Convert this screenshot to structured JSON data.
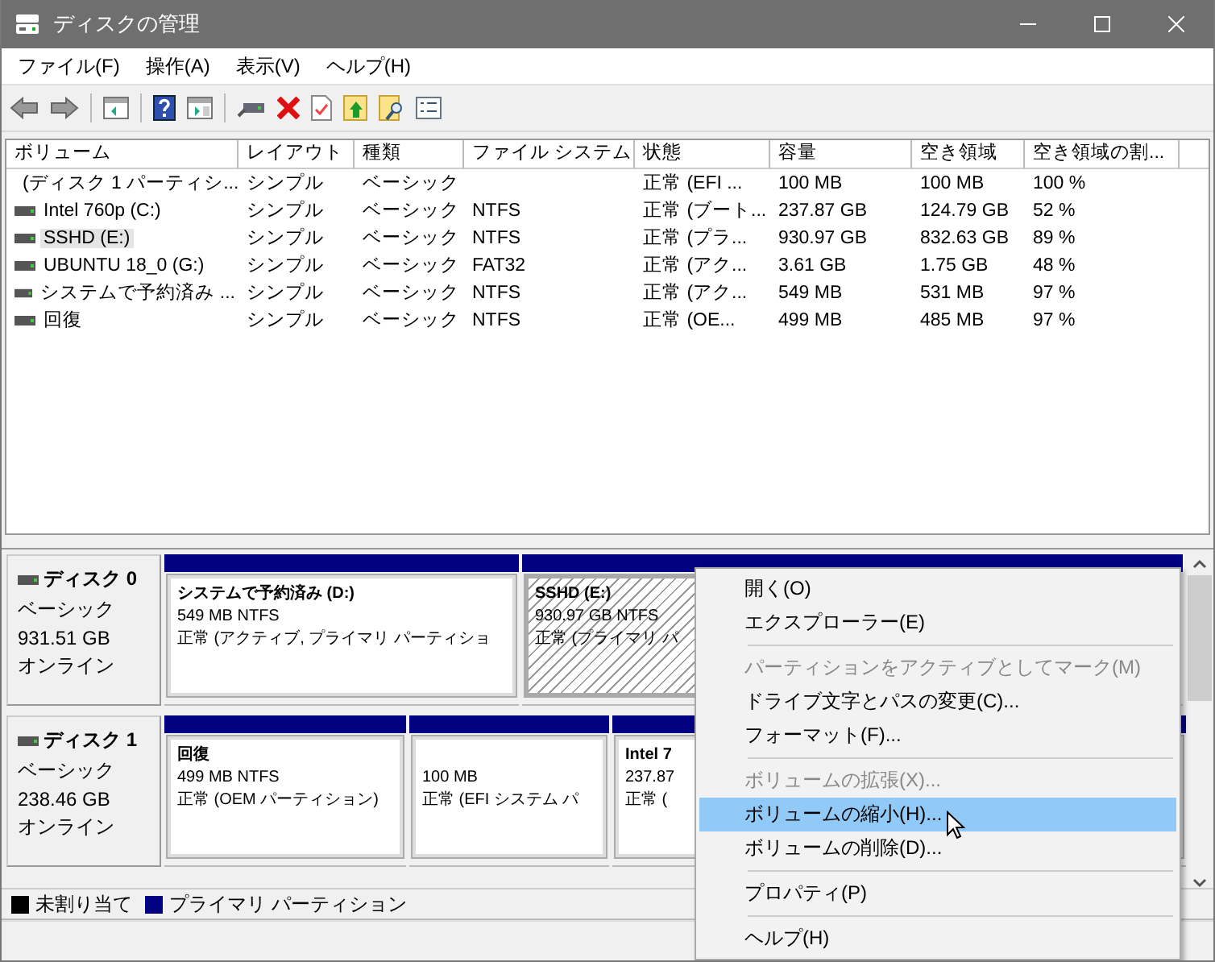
{
  "window": {
    "title": "ディスクの管理"
  },
  "menu_bar": [
    "ファイル(F)",
    "操作(A)",
    "表示(V)",
    "ヘルプ(H)"
  ],
  "volume_list": {
    "columns": [
      "ボリューム",
      "レイアウト",
      "種類",
      "ファイル システム",
      "状態",
      "容量",
      "空き領域",
      "空き領域の割..."
    ],
    "rows": [
      {
        "selected": false,
        "cells": [
          "(ディスク 1 パーティシ...",
          "シンプル",
          "ベーシック",
          "",
          "正常 (EFI ...",
          "100 MB",
          "100 MB",
          "100 %"
        ]
      },
      {
        "selected": false,
        "cells": [
          "Intel 760p (C:)",
          "シンプル",
          "ベーシック",
          "NTFS",
          "正常 (ブート...",
          "237.87 GB",
          "124.79 GB",
          "52 %"
        ]
      },
      {
        "selected": true,
        "cells": [
          "SSHD (E:)",
          "シンプル",
          "ベーシック",
          "NTFS",
          "正常 (プラ...",
          "930.97 GB",
          "832.63 GB",
          "89 %"
        ]
      },
      {
        "selected": false,
        "cells": [
          "UBUNTU 18_0 (G:)",
          "シンプル",
          "ベーシック",
          "FAT32",
          "正常 (アク...",
          "3.61 GB",
          "1.75 GB",
          "48 %"
        ]
      },
      {
        "selected": false,
        "cells": [
          "システムで予約済み ...",
          "シンプル",
          "ベーシック",
          "NTFS",
          "正常 (アク...",
          "549 MB",
          "531 MB",
          "97 %"
        ]
      },
      {
        "selected": false,
        "cells": [
          "回復",
          "シンプル",
          "ベーシック",
          "NTFS",
          "正常 (OE...",
          "499 MB",
          "485 MB",
          "97 %"
        ]
      }
    ]
  },
  "disks": [
    {
      "name": "ディスク 0",
      "type": "ベーシック",
      "size": "931.51 GB",
      "status": "オンライン",
      "partitions": [
        {
          "selected": false,
          "title": "システムで予約済み  (D:)",
          "detail": "549 MB NTFS",
          "state": "正常 (アクティブ, プライマリ パーティショ"
        },
        {
          "selected": true,
          "title": "SSHD  (E:)",
          "detail": "930.97 GB NTFS",
          "state": "正常 (プライマリ パ"
        }
      ]
    },
    {
      "name": "ディスク 1",
      "type": "ベーシック",
      "size": "238.46 GB",
      "status": "オンライン",
      "partitions": [
        {
          "selected": false,
          "title": "回復",
          "detail": "499 MB NTFS",
          "state": "正常 (OEM パーティション)"
        },
        {
          "selected": false,
          "detail": "100 MB",
          "state": "正常 (EFI システム パ"
        },
        {
          "selected": false,
          "title": "Intel 7",
          "detail": "237.87",
          "state": "正常 ("
        }
      ]
    }
  ],
  "legend": [
    {
      "label": "未割り当て",
      "color": "#000000"
    },
    {
      "label": "プライマリ パーティション",
      "color": "#000080"
    }
  ],
  "context_menu": [
    {
      "kind": "item",
      "label": "開く(O)",
      "disabled": false,
      "selected": false
    },
    {
      "kind": "item",
      "label": "エクスプローラー(E)",
      "disabled": false,
      "selected": false
    },
    {
      "kind": "separator"
    },
    {
      "kind": "item",
      "label": "パーティションをアクティブとしてマーク(M)",
      "disabled": true,
      "selected": false
    },
    {
      "kind": "item",
      "label": "ドライブ文字とパスの変更(C)...",
      "disabled": false,
      "selected": false
    },
    {
      "kind": "item",
      "label": "フォーマット(F)...",
      "disabled": false,
      "selected": false
    },
    {
      "kind": "separator"
    },
    {
      "kind": "item",
      "label": "ボリュームの拡張(X)...",
      "disabled": true,
      "selected": false
    },
    {
      "kind": "item",
      "label": "ボリュームの縮小(H)...",
      "disabled": false,
      "selected": true
    },
    {
      "kind": "item",
      "label": "ボリュームの削除(D)...",
      "disabled": false,
      "selected": false
    },
    {
      "kind": "separator"
    },
    {
      "kind": "item",
      "label": "プロパティ(P)",
      "disabled": false,
      "selected": false
    },
    {
      "kind": "separator"
    },
    {
      "kind": "item",
      "label": "ヘルプ(H)",
      "disabled": false,
      "selected": false
    }
  ]
}
